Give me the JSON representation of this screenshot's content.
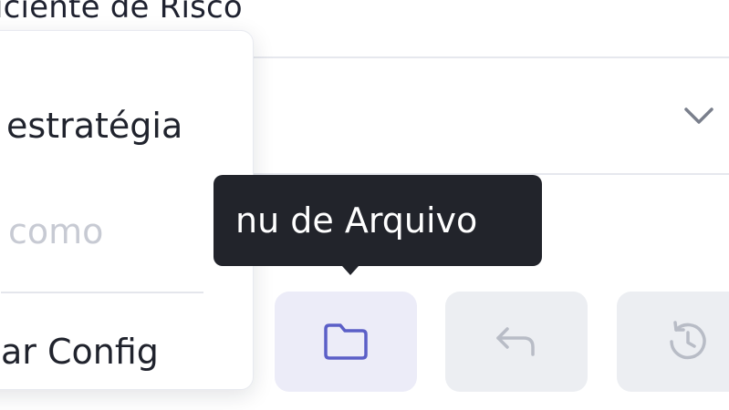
{
  "section": {
    "label": "iciente de Risco"
  },
  "select": {
    "chevron_icon": "chevron-down-icon"
  },
  "menu": {
    "items": [
      {
        "label": "estratégia",
        "state": "enabled"
      },
      {
        "label": "como",
        "state": "disabled"
      },
      {
        "label": "ar Config",
        "state": "enabled"
      }
    ]
  },
  "tooltip": {
    "text": "nu de Arquivo"
  },
  "toolbar": {
    "buttons": [
      {
        "icon": "folder-icon",
        "active": true,
        "color": "#5b5fc7"
      },
      {
        "icon": "undo-icon",
        "active": false,
        "color": "#b8bcc6"
      },
      {
        "icon": "history-icon",
        "active": false,
        "color": "#b8bcc6"
      }
    ]
  },
  "colors": {
    "accent": "#5b5fc7",
    "tooltip_bg": "#22242b",
    "disabled_text": "#c7cad3",
    "button_active_bg": "#ececf8",
    "button_bg": "#eceef2"
  }
}
